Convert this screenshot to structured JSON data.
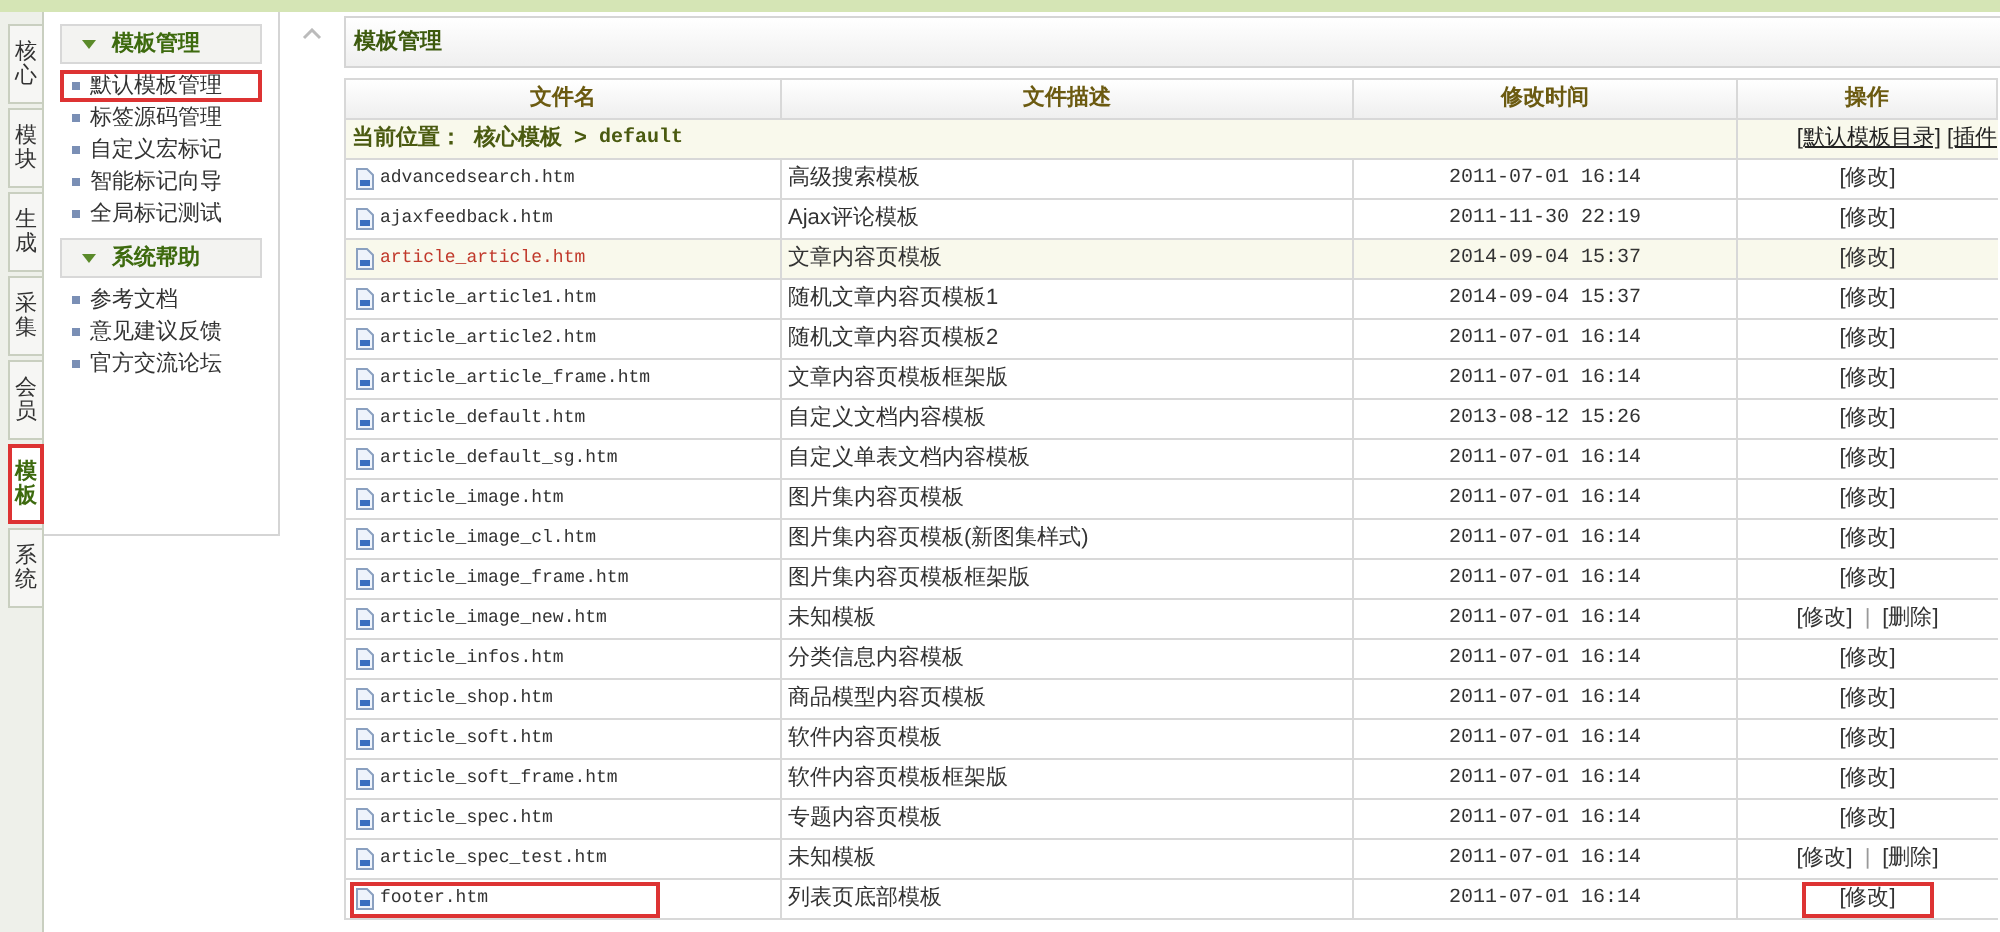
{
  "left_tabs": [
    {
      "label": "核心",
      "selected": false,
      "highlighted": false
    },
    {
      "label": "模块",
      "selected": false,
      "highlighted": false
    },
    {
      "label": "生成",
      "selected": false,
      "highlighted": false
    },
    {
      "label": "采集",
      "selected": false,
      "highlighted": false
    },
    {
      "label": "会员",
      "selected": false,
      "highlighted": false
    },
    {
      "label": "模板",
      "selected": true,
      "highlighted": true
    },
    {
      "label": "系统",
      "selected": false,
      "highlighted": false
    }
  ],
  "sidebar": {
    "sections": [
      {
        "title": "模板管理",
        "expanded": true,
        "items": [
          {
            "label": "默认模板管理",
            "highlighted": true
          },
          {
            "label": "标签源码管理",
            "highlighted": false
          },
          {
            "label": "自定义宏标记",
            "highlighted": false
          },
          {
            "label": "智能标记向导",
            "highlighted": false
          },
          {
            "label": "全局标记测试",
            "highlighted": false
          }
        ]
      },
      {
        "title": "系统帮助",
        "expanded": true,
        "items": [
          {
            "label": "参考文档",
            "highlighted": false
          },
          {
            "label": "意见建议反馈",
            "highlighted": false
          },
          {
            "label": "官方交流论坛",
            "highlighted": false
          }
        ]
      }
    ]
  },
  "panel": {
    "title": "模板管理",
    "table": {
      "columns": [
        "文件名",
        "文件描述",
        "修改时间",
        "操作"
      ],
      "location": {
        "label": "当前位置：",
        "path": "核心模板",
        "separator": ">",
        "folder": "default",
        "links": [
          "[默认模板目录]",
          "[插件"
        ]
      },
      "rows": [
        {
          "file": "advancedsearch.htm",
          "description": "高级搜索模板",
          "modified": "2011-07-01 16:14",
          "selected": false,
          "highlighted": false,
          "actions": [
            {
              "kind": "link",
              "label": "[修改]"
            }
          ]
        },
        {
          "file": "ajaxfeedback.htm",
          "description": "Ajax评论模板",
          "modified": "2011-11-30 22:19",
          "selected": false,
          "highlighted": false,
          "actions": [
            {
              "kind": "link",
              "label": "[修改]"
            }
          ]
        },
        {
          "file": "article_article.htm",
          "description": "文章内容页模板",
          "modified": "2014-09-04 15:37",
          "selected": true,
          "highlighted": false,
          "actions": [
            {
              "kind": "link",
              "label": "[修改]"
            }
          ]
        },
        {
          "file": "article_article1.htm",
          "description": "随机文章内容页模板1",
          "modified": "2014-09-04 15:37",
          "selected": false,
          "highlighted": false,
          "actions": [
            {
              "kind": "link",
              "label": "[修改]"
            }
          ]
        },
        {
          "file": "article_article2.htm",
          "description": "随机文章内容页模板2",
          "modified": "2011-07-01 16:14",
          "selected": false,
          "highlighted": false,
          "actions": [
            {
              "kind": "link",
              "label": "[修改]"
            }
          ]
        },
        {
          "file": "article_article_frame.htm",
          "description": "文章内容页模板框架版",
          "modified": "2011-07-01 16:14",
          "selected": false,
          "highlighted": false,
          "actions": [
            {
              "kind": "link",
              "label": "[修改]"
            }
          ]
        },
        {
          "file": "article_default.htm",
          "description": "自定义文档内容模板",
          "modified": "2013-08-12 15:26",
          "selected": false,
          "highlighted": false,
          "actions": [
            {
              "kind": "link",
              "label": "[修改]"
            }
          ]
        },
        {
          "file": "article_default_sg.htm",
          "description": "自定义单表文档内容模板",
          "modified": "2011-07-01 16:14",
          "selected": false,
          "highlighted": false,
          "actions": [
            {
              "kind": "link",
              "label": "[修改]"
            }
          ]
        },
        {
          "file": "article_image.htm",
          "description": "图片集内容页模板",
          "modified": "2011-07-01 16:14",
          "selected": false,
          "highlighted": false,
          "actions": [
            {
              "kind": "link",
              "label": "[修改]"
            }
          ]
        },
        {
          "file": "article_image_cl.htm",
          "description": "图片集内容页模板(新图集样式)",
          "modified": "2011-07-01 16:14",
          "selected": false,
          "highlighted": false,
          "actions": [
            {
              "kind": "link",
              "label": "[修改]"
            }
          ]
        },
        {
          "file": "article_image_frame.htm",
          "description": "图片集内容页模板框架版",
          "modified": "2011-07-01 16:14",
          "selected": false,
          "highlighted": false,
          "actions": [
            {
              "kind": "link",
              "label": "[修改]"
            }
          ]
        },
        {
          "file": "article_image_new.htm",
          "description": "未知模板",
          "modified": "2011-07-01 16:14",
          "selected": false,
          "highlighted": false,
          "actions": [
            {
              "kind": "link",
              "label": "[修改]"
            },
            {
              "kind": "separator",
              "label": "|"
            },
            {
              "kind": "link",
              "label": "[删除]"
            }
          ]
        },
        {
          "file": "article_infos.htm",
          "description": "分类信息内容模板",
          "modified": "2011-07-01 16:14",
          "selected": false,
          "highlighted": false,
          "actions": [
            {
              "kind": "link",
              "label": "[修改]"
            }
          ]
        },
        {
          "file": "article_shop.htm",
          "description": "商品模型内容页模板",
          "modified": "2011-07-01 16:14",
          "selected": false,
          "highlighted": false,
          "actions": [
            {
              "kind": "link",
              "label": "[修改]"
            }
          ]
        },
        {
          "file": "article_soft.htm",
          "description": "软件内容页模板",
          "modified": "2011-07-01 16:14",
          "selected": false,
          "highlighted": false,
          "actions": [
            {
              "kind": "link",
              "label": "[修改]"
            }
          ]
        },
        {
          "file": "article_soft_frame.htm",
          "description": "软件内容页模板框架版",
          "modified": "2011-07-01 16:14",
          "selected": false,
          "highlighted": false,
          "actions": [
            {
              "kind": "link",
              "label": "[修改]"
            }
          ]
        },
        {
          "file": "article_spec.htm",
          "description": "专题内容页模板",
          "modified": "2011-07-01 16:14",
          "selected": false,
          "highlighted": false,
          "actions": [
            {
              "kind": "link",
              "label": "[修改]"
            }
          ]
        },
        {
          "file": "article_spec_test.htm",
          "description": "未知模板",
          "modified": "2011-07-01 16:14",
          "selected": false,
          "highlighted": false,
          "actions": [
            {
              "kind": "link",
              "label": "[修改]"
            },
            {
              "kind": "separator",
              "label": "|"
            },
            {
              "kind": "link",
              "label": "[删除]"
            }
          ]
        },
        {
          "file": "footer.htm",
          "description": "列表页底部模板",
          "modified": "2011-07-01 16:14",
          "selected": false,
          "highlighted": true,
          "actions": [
            {
              "kind": "link",
              "label": "[修改]"
            }
          ]
        }
      ]
    }
  }
}
